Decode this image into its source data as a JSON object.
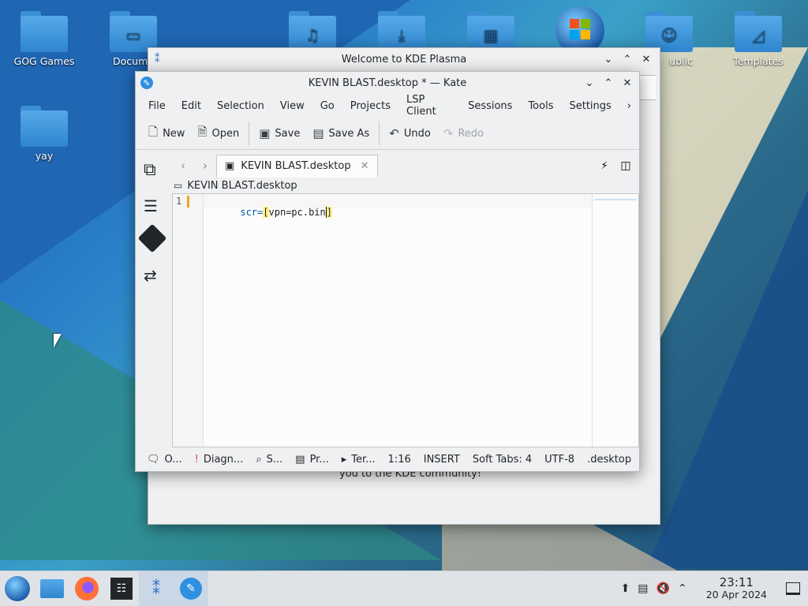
{
  "desktop": {
    "icons": [
      {
        "label": "GOG Games"
      },
      {
        "label": "Docume"
      },
      {
        "label": ""
      },
      {
        "label": ""
      },
      {
        "label": ""
      },
      {
        "label": "ublic"
      },
      {
        "label": "Templates"
      },
      {
        "label": "yay"
      }
    ]
  },
  "welcome": {
    "title": "Welcome to KDE Plasma",
    "footer_text": "you to the KDE community!"
  },
  "kate": {
    "title": "KEVIN BLAST.desktop * — Kate",
    "menu": [
      "File",
      "Edit",
      "Selection",
      "View",
      "Go",
      "Projects",
      "LSP Client",
      "Sessions",
      "Tools",
      "Settings"
    ],
    "toolbar": {
      "new": "New",
      "open": "Open",
      "save": "Save",
      "save_as": "Save As",
      "undo": "Undo",
      "redo": "Redo"
    },
    "tab_label": "KEVIN BLAST.desktop",
    "breadcrumb": "KEVIN BLAST.desktop",
    "line_number": "1",
    "code_prefix": "scr=",
    "code_bracket_open": "[",
    "code_middle": "vpn=pc.bin",
    "code_bracket_close": "]",
    "status": {
      "output": "O...",
      "diagnostics": "Diagn...",
      "search": "S...",
      "projects": "Pr...",
      "terminal": "Ter...",
      "position": "1:16",
      "mode": "INSERT",
      "indent": "Soft Tabs: 4",
      "encoding": "UTF-8",
      "filetype": ".desktop"
    }
  },
  "taskbar": {
    "clock_time": "23:11",
    "clock_date": "20 Apr 2024"
  }
}
